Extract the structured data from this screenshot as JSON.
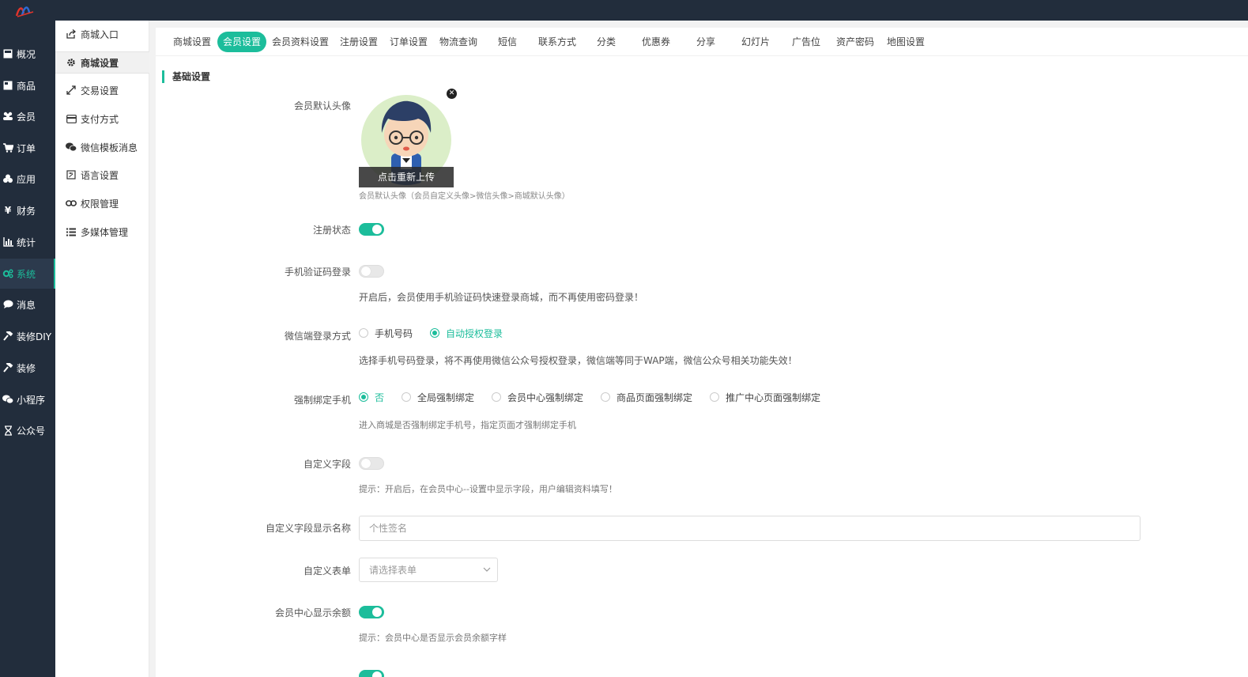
{
  "sidebar": {
    "items": [
      {
        "label": "概况",
        "icon": "overview-icon"
      },
      {
        "label": "商品",
        "icon": "goods-icon"
      },
      {
        "label": "会员",
        "icon": "users-icon"
      },
      {
        "label": "订单",
        "icon": "cart-icon"
      },
      {
        "label": "应用",
        "icon": "apps-icon"
      },
      {
        "label": "财务",
        "icon": "yen-icon"
      },
      {
        "label": "统计",
        "icon": "bar-chart-icon"
      },
      {
        "label": "系统",
        "icon": "gears-icon"
      },
      {
        "label": "消息",
        "icon": "message-icon"
      },
      {
        "label": "装修DIY",
        "icon": "hammer-icon"
      },
      {
        "label": "装修",
        "icon": "hammer-icon"
      },
      {
        "label": "小程序",
        "icon": "wechat-icon"
      },
      {
        "label": "公众号",
        "icon": "hourglass-icon"
      }
    ],
    "active_index": 7
  },
  "subnav": {
    "items": [
      {
        "label": "商城入口",
        "icon": "share-icon"
      },
      {
        "label": "商城设置",
        "icon": "gear-icon"
      },
      {
        "label": "交易设置",
        "icon": "exchange-icon"
      },
      {
        "label": "支付方式",
        "icon": "card-icon"
      },
      {
        "label": "微信模板消息",
        "icon": "wechat-icon"
      },
      {
        "label": "语言设置",
        "icon": "language-icon"
      },
      {
        "label": "权限管理",
        "icon": "link-icon"
      },
      {
        "label": "多媒体管理",
        "icon": "list-icon"
      }
    ],
    "active_index": 1
  },
  "tabs": [
    {
      "label": "商城设置"
    },
    {
      "label": "会员设置"
    },
    {
      "label": "会员资料设置"
    },
    {
      "label": "注册设置"
    },
    {
      "label": "订单设置"
    },
    {
      "label": "物流查询"
    },
    {
      "label": "短信"
    },
    {
      "label": "联系方式"
    },
    {
      "label": "分类"
    },
    {
      "label": "优惠券"
    },
    {
      "label": "分享"
    },
    {
      "label": "幻灯片"
    },
    {
      "label": "广告位"
    },
    {
      "label": "资产密码"
    },
    {
      "label": "地图设置"
    }
  ],
  "active_tab": 1,
  "form": {
    "section_title": "基础设置",
    "avatar": {
      "label": "会员默认头像",
      "upload_label": "点击重新上传",
      "close_label": "✕",
      "hint": "会员默认头像（会员自定义头像>微信头像>商城默认头像）"
    },
    "register_status": {
      "label": "注册状态",
      "on": true
    },
    "sms_login": {
      "label": "手机验证码登录",
      "on": false,
      "hint": "开启后，会员使用手机验证码快速登录商城，而不再使用密码登录！"
    },
    "wechat_login": {
      "label": "微信端登录方式",
      "options": [
        "手机号码",
        "自动授权登录"
      ],
      "selected": 1,
      "hint": "选择手机号码登录，将不再使用微信公众号授权登录，微信端等同于WAP端，微信公众号相关功能失效！"
    },
    "force_bind": {
      "label": "强制绑定手机",
      "options": [
        "否",
        "全局强制绑定",
        "会员中心强制绑定",
        "商品页面强制绑定",
        "推广中心页面强制绑定"
      ],
      "selected": 0,
      "hint": "进入商城是否强制绑定手机号，指定页面才强制绑定手机"
    },
    "custom_field": {
      "label": "自定义字段",
      "on": false,
      "hint": "提示：开启后，在会员中心--设置中显示字段，用户编辑资料填写！"
    },
    "custom_field_name": {
      "label": "自定义字段显示名称",
      "placeholder": "个性签名",
      "value": ""
    },
    "custom_form": {
      "label": "自定义表单",
      "placeholder": "请选择表单"
    },
    "show_balance": {
      "label": "会员中心显示余额",
      "on": true,
      "hint": "提示：会员中心是否显示会员余额字样"
    }
  },
  "colors": {
    "accent": "#1cbd9b",
    "sidebar_bg": "#222d3c"
  }
}
